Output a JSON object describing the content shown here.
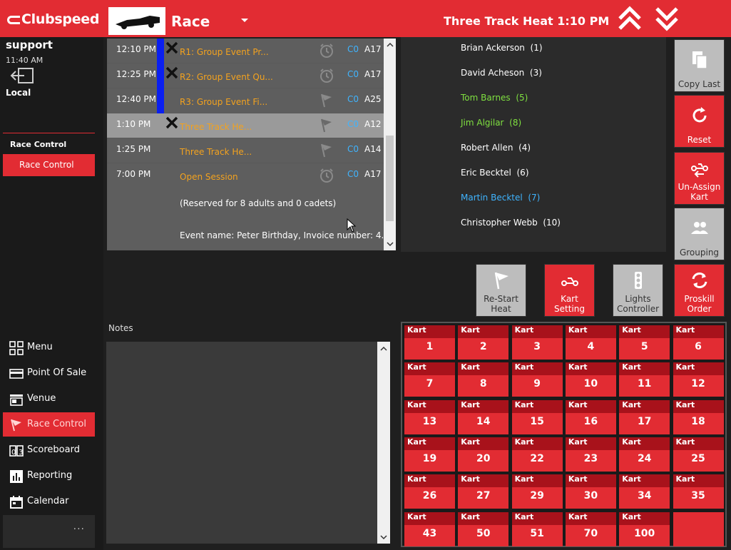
{
  "header": {
    "brand": "Clubspeed",
    "race_label": "Race",
    "heat_title": "Three Track Heat 1:10 PM"
  },
  "sidebar": {
    "user": "support",
    "time": "11:40 AM",
    "location": "Local",
    "section_heading": "Race Control",
    "section_item": "Race Control",
    "nav": [
      {
        "label": "Menu",
        "icon": "grid-icon"
      },
      {
        "label": "Point Of Sale",
        "icon": "credit-card-icon"
      },
      {
        "label": "Venue",
        "icon": "store-icon"
      },
      {
        "label": "Race Control",
        "icon": "flag-icon"
      },
      {
        "label": "Scoreboard",
        "icon": "scoreboard-icon"
      },
      {
        "label": "Reporting",
        "icon": "bar-chart-icon"
      },
      {
        "label": "Calendar",
        "icon": "calendar-icon"
      }
    ],
    "more": "···"
  },
  "heats": [
    {
      "time": "12:10 PM",
      "name": "R1: Group Event Pr...",
      "co": "C0",
      "track": "A17"
    },
    {
      "time": "12:25 PM",
      "name": "R2: Group Event Qu...",
      "co": "C0",
      "track": "A17"
    },
    {
      "time": "12:40 PM",
      "name": "R3: Group Event Fi...",
      "co": "C0",
      "track": "A25"
    },
    {
      "time": "1:10 PM",
      "name": "Three Track He...",
      "co": "C0",
      "track": "A12"
    },
    {
      "time": "1:25 PM",
      "name": "Three Track He...",
      "co": "C0",
      "track": "A14"
    },
    {
      "time": "7:00 PM",
      "name": "Open Session",
      "co": "C0",
      "track": "A17"
    }
  ],
  "heat_info": {
    "reserved": "(Reserved for 8 adults and 0 cadets)",
    "event": "Event name: Peter Birthday, Invoice number: 4..."
  },
  "racers": [
    {
      "name": "Brian Ackerson",
      "num": "(1)",
      "color": "#ffffff"
    },
    {
      "name": "David Acheson",
      "num": "(3)",
      "color": "#ffffff"
    },
    {
      "name": "Tom Barnes",
      "num": "(5)",
      "color": "#7fe040"
    },
    {
      "name": "Jim Algilar",
      "num": "(8)",
      "color": "#7fe040"
    },
    {
      "name": "Robert Allen",
      "num": "(4)",
      "color": "#ffffff"
    },
    {
      "name": "Eric Becktel",
      "num": "(6)",
      "color": "#ffffff"
    },
    {
      "name": "Martin Becktel",
      "num": "(7)",
      "color": "#3fb4ff"
    },
    {
      "name": "Christopher Webb",
      "num": "(10)",
      "color": "#ffffff"
    }
  ],
  "tools": {
    "copy_last": "Copy Last",
    "reset": "Reset",
    "unassign_1": "Un-Assign",
    "unassign_2": "Kart",
    "grouping": "Grouping",
    "restart_1": "Re-Start",
    "restart_2": "Heat",
    "kart_setting_1": "Kart",
    "kart_setting_2": "Setting",
    "lights_1": "Lights",
    "lights_2": "Controller",
    "proskill_1": "Proskill",
    "proskill_2": "Order"
  },
  "notes_label": "Notes",
  "kart_label": "Kart",
  "karts": [
    "1",
    "2",
    "3",
    "4",
    "5",
    "6",
    "7",
    "8",
    "9",
    "10",
    "11",
    "12",
    "13",
    "14",
    "15",
    "16",
    "17",
    "18",
    "19",
    "20",
    "22",
    "23",
    "24",
    "25",
    "26",
    "27",
    "29",
    "30",
    "34",
    "35",
    "43",
    "50",
    "51",
    "70",
    "100"
  ],
  "colors": {
    "accent": "#e22c33",
    "dark_red": "#a8121b",
    "orange": "#f3a21e",
    "blue": "#3fb4ff"
  }
}
